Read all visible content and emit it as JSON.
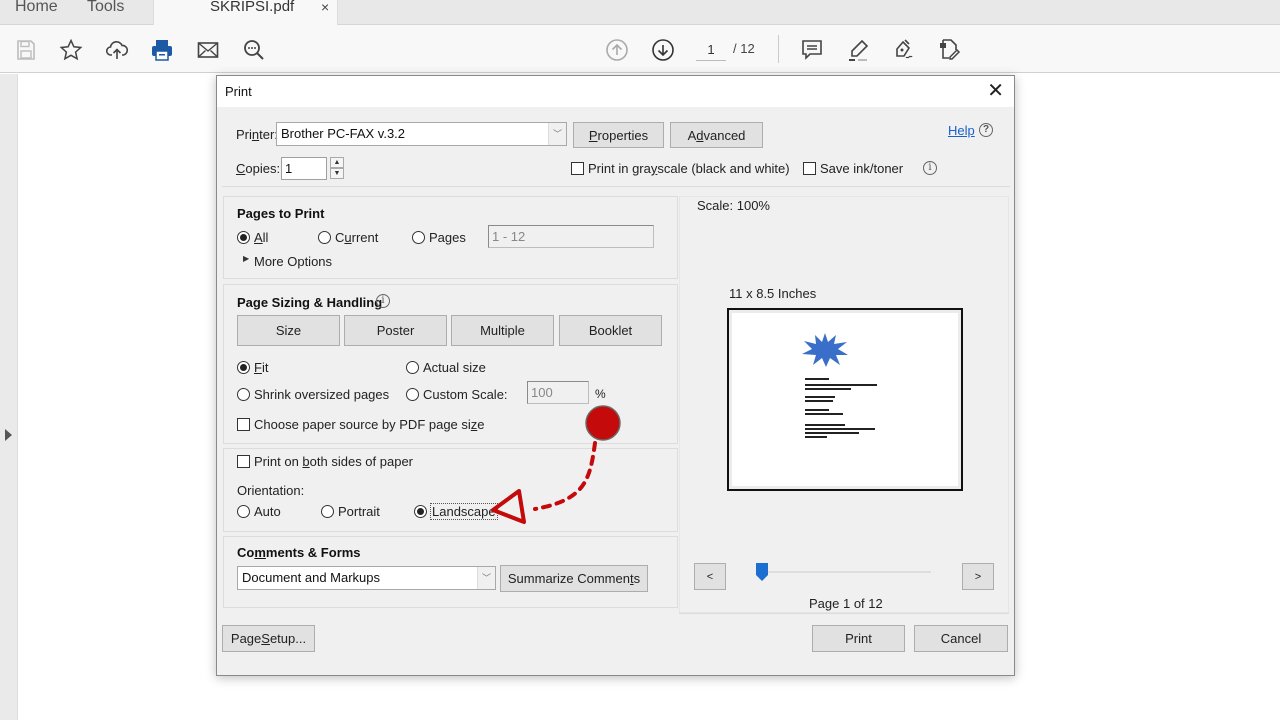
{
  "app": {
    "tabs": {
      "home": "Home",
      "tools": "Tools"
    },
    "document_tab": {
      "title": "SKRIPSI.pdf",
      "close": "×"
    },
    "toolbar": {
      "icons": [
        "save-icon",
        "bookmark-star-icon",
        "upload-cloud-icon",
        "print-icon",
        "email-icon",
        "search-zoom-icon",
        "page-up-icon",
        "page-down-icon",
        "comment-icon",
        "highlight-pen-icon",
        "fill-sign-icon",
        "edit-pdf-icon"
      ],
      "current_page": "1",
      "page_total": "/ 12"
    }
  },
  "dialog": {
    "title": "Print",
    "close": "✕",
    "printer": {
      "label_pre": "Pri",
      "label_ul": "n",
      "label_post": "ter:",
      "value": "Brother PC-FAX v.3.2"
    },
    "properties_button": {
      "ul": "P",
      "rest": "roperties"
    },
    "advanced_button": {
      "pre": "A",
      "ul": "d",
      "rest": "vanced"
    },
    "help_link": "Help",
    "copies": {
      "label_ul": "C",
      "label_rest": "opies:",
      "value": "1"
    },
    "grayscale": {
      "label_pre": "Print in gra",
      "label_ul": "y",
      "label_post": "scale (black and white)",
      "checked": false
    },
    "save_ink": {
      "label": "Save ink/toner",
      "checked": false
    },
    "pages_to_print": {
      "title": "Pages to Print",
      "options": [
        {
          "ul": "A",
          "rest": "ll",
          "pre": "",
          "checked": true
        },
        {
          "pre": "C",
          "ul": "u",
          "rest": "rrent",
          "checked": false
        },
        {
          "pre": "Pa",
          "ul": "g",
          "rest": "es",
          "checked": false
        }
      ],
      "range_value": "1 - 12",
      "more_options": "More Options"
    },
    "page_sizing": {
      "title": "Page Sizing & Handling",
      "modes": [
        "Size",
        "Poster",
        "Multiple",
        "Booklet"
      ],
      "fit": {
        "ul": "F",
        "rest": "it",
        "checked": true
      },
      "actual_size": {
        "label": "Actual size",
        "checked": false
      },
      "shrink": {
        "label": "Shrink oversized pages",
        "checked": false
      },
      "custom_scale": {
        "label": "Custom Scale:",
        "checked": false,
        "value": "100",
        "unit": "%"
      },
      "paper_source": {
        "pre": "Choose paper source by PDF page si",
        "ul": "z",
        "rest": "e",
        "checked": false
      }
    },
    "duplex": {
      "pre": "Print on ",
      "ul": "b",
      "rest": "oth sides of paper",
      "checked": false
    },
    "orientation": {
      "label": "Orientation:",
      "options": [
        {
          "label": "Auto",
          "checked": false
        },
        {
          "label": "Portrait",
          "checked": false
        },
        {
          "label": "Landscape",
          "checked": true
        }
      ]
    },
    "comments_forms": {
      "title_pre": "Co",
      "title_ul": "m",
      "title_rest": "ments & Forms",
      "value": "Document and Markups",
      "summarize_pre": "Summarize Commen",
      "summarize_ul": "t",
      "summarize_rest": "s"
    },
    "preview": {
      "scale": "Scale: 100%",
      "paper_size": "11 x 8.5 Inches",
      "prev": "<",
      "next": ">",
      "page_label": "Page 1 of 12",
      "current_page": 1,
      "total_pages": 12
    },
    "page_setup": {
      "pre": "Page ",
      "ul": "S",
      "rest": "etup..."
    },
    "print_button": "Print",
    "cancel_button": "Cancel"
  },
  "annotation": {
    "color": "#c40000",
    "target": "Landscape"
  }
}
